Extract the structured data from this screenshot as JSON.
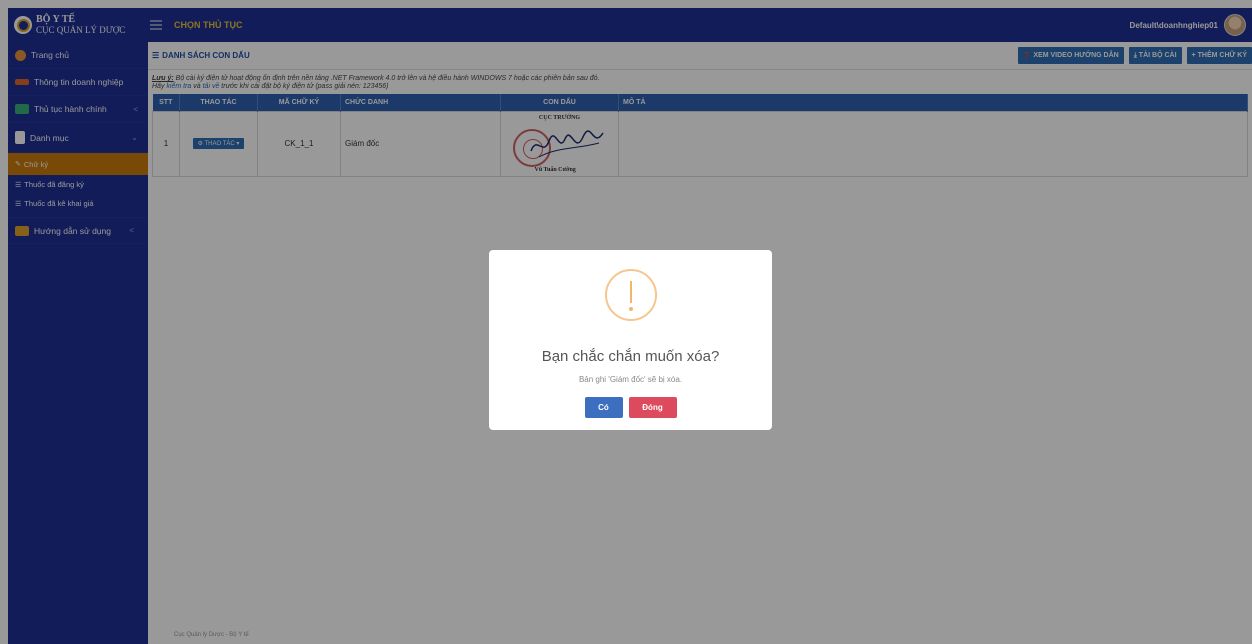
{
  "app": {
    "brand_line1": "BỘ Y TẾ",
    "brand_line2": "CỤC QUẢN LÝ DƯỢC",
    "page_title": "CHỌN THỦ TỤC",
    "username": "Default\\doanhnghiep01"
  },
  "sidebar": {
    "items": [
      {
        "label": "Trang chủ",
        "icon": "home-icon",
        "color": "#e8923a"
      },
      {
        "label": "Thông tin doanh nghiệp",
        "icon": "book-icon",
        "color": "#e0662b"
      },
      {
        "label": "Thủ tục hành chính",
        "icon": "folder-icon",
        "color": "#3ab07a",
        "arrow": "<"
      },
      {
        "label": "Danh mục",
        "icon": "file-icon",
        "color": "#ffffff",
        "arrow": "⌄"
      }
    ],
    "subitems": [
      {
        "label": "Chữ ký",
        "icon": "pen-icon",
        "active": true
      },
      {
        "label": "Thuốc đã đăng ký",
        "icon": "list-icon"
      },
      {
        "label": "Thuốc đã kê khai giá",
        "icon": "list-icon"
      }
    ],
    "guide": {
      "label": "Hướng dẫn sử dụng",
      "icon": "folder-icon",
      "color": "#e0a22b",
      "arrow": "<"
    }
  },
  "panel": {
    "title": "DANH SÁCH CON DẤU",
    "buttons": [
      {
        "label": "XEM VIDEO HƯỚNG DẪN",
        "icon": "question-icon",
        "glyph": "❓"
      },
      {
        "label": "TẢI BỘ CÀI",
        "icon": "download-icon",
        "glyph": "⤓"
      },
      {
        "label": "THÊM CHỮ KÝ",
        "icon": "plus-icon",
        "glyph": "+"
      }
    ],
    "note_prefix": "Lưu ý:",
    "note_line1": " Bộ cài ký điện tử hoạt động ổn định trên nền tảng .NET Framework 4.0 trở lên và hệ điều hành WINDOWS 7 hoặc các phiên bản sau đó.",
    "note_line2_a": "Hãy ",
    "note_link1": "kiểm tra",
    "note_line2_b": " và ",
    "note_link2": "tải về",
    "note_line2_c": " trước khi cài đặt bộ ký điện tử (pass giải nén: 123456)"
  },
  "table": {
    "headers": [
      "STT",
      "THAO TÁC",
      "MÃ CHỮ KÝ",
      "CHỨC DANH",
      "CON DẤU",
      "MÔ TẢ"
    ],
    "rows": [
      {
        "stt": "1",
        "action": "THAO TÁC",
        "code": "CK_1_1",
        "title": "Giám đốc",
        "stamp_title": "CỤC TRƯỞNG",
        "stamp_sub": "",
        "stamp_name": "Vũ Tuấn Cường",
        "description": ""
      }
    ]
  },
  "footer": "Cục Quản lý Dược - Bộ Y tế",
  "modal": {
    "title": "Bạn chắc chắn muốn xóa?",
    "message": "Bản ghi 'Giám đốc' sẽ bị xóa.",
    "confirm": "Có",
    "cancel": "Đóng",
    "icon": "warning-icon"
  }
}
